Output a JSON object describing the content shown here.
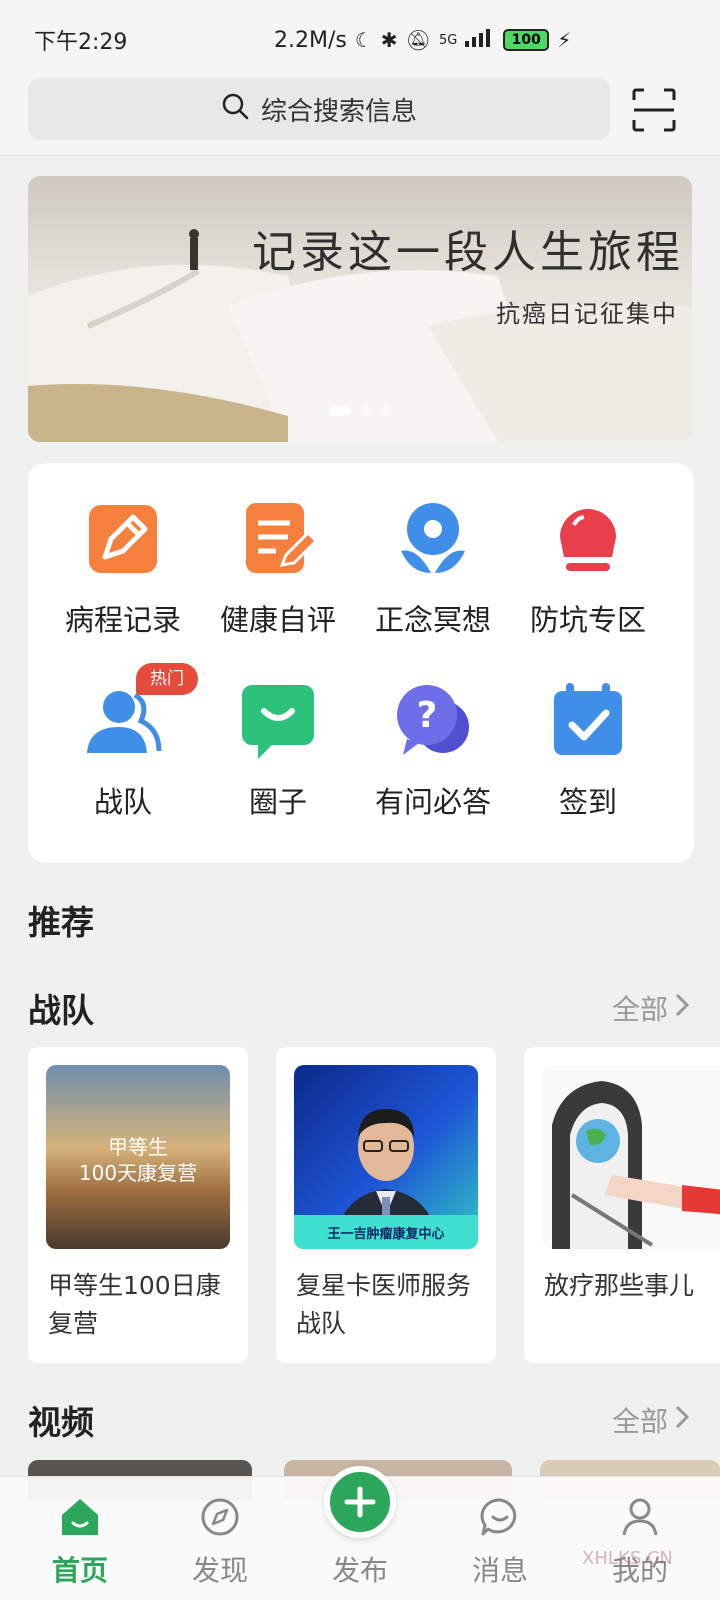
{
  "status_bar": {
    "time": "下午2:29",
    "speed": "2.2M/s",
    "network": "5G",
    "battery": "100"
  },
  "search": {
    "placeholder": "综合搜索信息"
  },
  "banner": {
    "title": "记录这一段人生旅程",
    "subtitle": "抗癌日记征集中",
    "slide_count": 3,
    "active_slide": 1
  },
  "quick_grid": {
    "items": [
      {
        "label": "病程记录",
        "icon": "edit-icon",
        "color": "#f5803e"
      },
      {
        "label": "健康自评",
        "icon": "document-pen-icon",
        "color": "#f5803e"
      },
      {
        "label": "正念冥想",
        "icon": "flower-icon",
        "color": "#3f8ee8"
      },
      {
        "label": "防坑专区",
        "icon": "alarm-light-icon",
        "color": "#e83f4a"
      },
      {
        "label": "战队",
        "icon": "team-icon",
        "color": "#3f8ee8"
      },
      {
        "label": "圈子",
        "icon": "chat-smile-icon",
        "color": "#2cc27c"
      },
      {
        "label": "有问必答",
        "icon": "question-bubble-icon",
        "color": "#6d6ee8"
      },
      {
        "label": "签到",
        "icon": "calendar-check-icon",
        "color": "#3f8ee8"
      }
    ],
    "hot_badge": "热门"
  },
  "recommend": {
    "title": "推荐"
  },
  "teams": {
    "title": "战队",
    "more": "全部",
    "cards": [
      {
        "name": "甲等生100日康复营",
        "thumb_text_1": "甲等生",
        "thumb_text_2": "100天康复营"
      },
      {
        "name": "复星卡医师服务战队",
        "thumb_caption": "王一吉肿瘤康复中心"
      },
      {
        "name": "放疗那些事儿"
      }
    ]
  },
  "videos": {
    "title": "视频",
    "more": "全部"
  },
  "bottom_nav": {
    "items": [
      {
        "label": "首页",
        "icon": "home-icon",
        "active": true
      },
      {
        "label": "发现",
        "icon": "compass-icon",
        "active": false
      },
      {
        "label": "发布",
        "icon": "plus-icon",
        "active": false
      },
      {
        "label": "消息",
        "icon": "message-icon",
        "active": false
      },
      {
        "label": "我的",
        "icon": "user-icon",
        "active": false
      }
    ]
  },
  "watermark": "XHLKS.CN"
}
